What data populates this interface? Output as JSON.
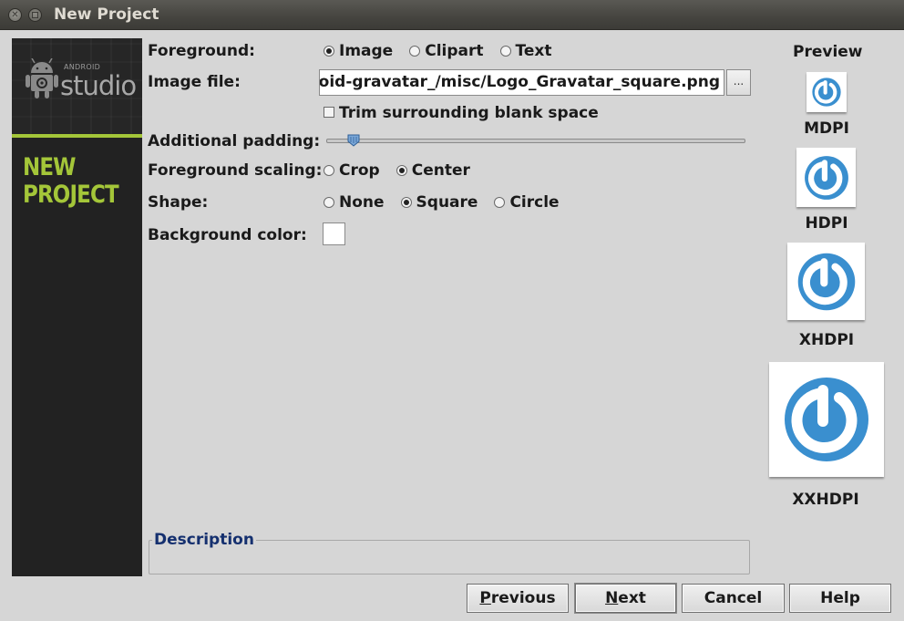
{
  "window": {
    "title": "New Project"
  },
  "banner": {
    "android_text": "ANDROID",
    "studio_text": "studio",
    "heading_line1": "NEW",
    "heading_line2": "PROJECT",
    "accent_color": "#a4c639"
  },
  "form": {
    "foreground_label": "Foreground:",
    "foreground_options": [
      "Image",
      "Clipart",
      "Text"
    ],
    "foreground_selected": "Image",
    "image_file_label": "Image file:",
    "image_file_value": "roid-gravatar_/misc/Logo_Gravatar_square.png",
    "browse_label": "...",
    "trim_label": "Trim surrounding blank space",
    "trim_checked": false,
    "padding_label": "Additional padding:",
    "padding_value_fraction": 0.05,
    "scaling_label": "Foreground scaling:",
    "scaling_options": [
      "Crop",
      "Center"
    ],
    "scaling_selected": "Center",
    "shape_label": "Shape:",
    "shape_options": [
      "None",
      "Square",
      "Circle"
    ],
    "shape_selected": "Square",
    "background_color_label": "Background color:",
    "background_color": "#ffffff"
  },
  "preview": {
    "title": "Preview",
    "icon_color": "#3a8fcf",
    "densities": [
      "MDPI",
      "HDPI",
      "XHDPI",
      "XXHDPI"
    ]
  },
  "description": {
    "legend": "Description"
  },
  "buttons": {
    "previous": "Previous",
    "next": "Next",
    "cancel": "Cancel",
    "help": "Help"
  }
}
